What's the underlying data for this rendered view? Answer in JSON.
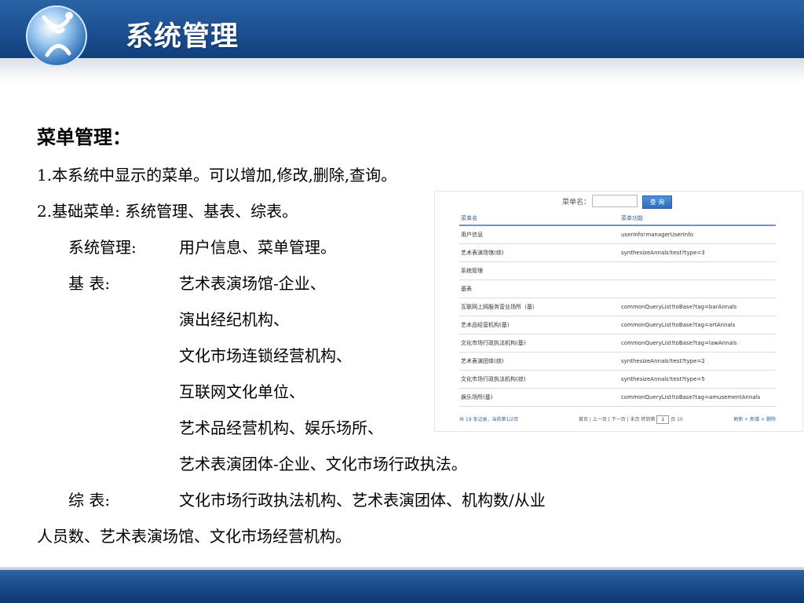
{
  "header": {
    "title": "系统管理"
  },
  "main": {
    "heading": "菜单管理：",
    "line1": "1.本系统中显示的菜单。可以增加,修改,删除,查询。",
    "line2": "2.基础菜单:   系统管理、基表、综表。",
    "sys_label": "系统管理:",
    "sys_value": "用户信息、菜单管理。",
    "base_label": "基      表:",
    "base_items": [
      "艺术表演场馆-企业、",
      "演出经纪机构、",
      "文化市场连锁经营机构、",
      "互联网文化单位、",
      "艺术品经营机构、娱乐场所、",
      "艺术表演团体-企业、文化市场行政执法。"
    ],
    "summary_label": "综      表:",
    "summary_line1": "文化市场行政执法机构、艺术表演团体、机构数/从业",
    "summary_line2": "人员数、艺术表演场馆、文化市场经营机构。"
  },
  "screenshot": {
    "search_label": "菜单名：",
    "search_button": "查 询",
    "columns": [
      "菜单名",
      "菜单功能"
    ],
    "rows": [
      [
        "用户信息",
        "userInfo!managerUserInfo"
      ],
      [
        "艺术表演场馆(综)",
        "synthesizeAnnals!test?type=3"
      ],
      [
        "系统管理",
        ""
      ],
      [
        "基表",
        ""
      ],
      [
        "互联网上网服务营业场所（基）",
        "commonQueryList!toBase?tag=barAnnals"
      ],
      [
        "艺术品经营机构(基)",
        "commonQueryList!toBase?tag=artAnnals"
      ],
      [
        "文化市场行政执法机构(基)",
        "commonQueryList!toBase?tag=lawAnnals"
      ],
      [
        "艺术表演团体(综)",
        "synthesizeAnnals!test?type=2"
      ],
      [
        "文化市场行政执法机构(综)",
        "synthesizeAnnals!test?type=5"
      ],
      [
        "娱乐场所(基)",
        "commonQueryList!toBase?tag=amusementAnnals"
      ]
    ],
    "pager_info": "共 19 条记录，当前第1/2页",
    "pager_nav": "首页 | 上一页 | 下一页 | 末页  转到第",
    "pager_page": "1",
    "pager_size": "页 10",
    "pager_actions": "刷新  + 新增  × 删除"
  },
  "colors": {
    "header_bg": "#1c4f92",
    "link": "#3b5f98"
  }
}
